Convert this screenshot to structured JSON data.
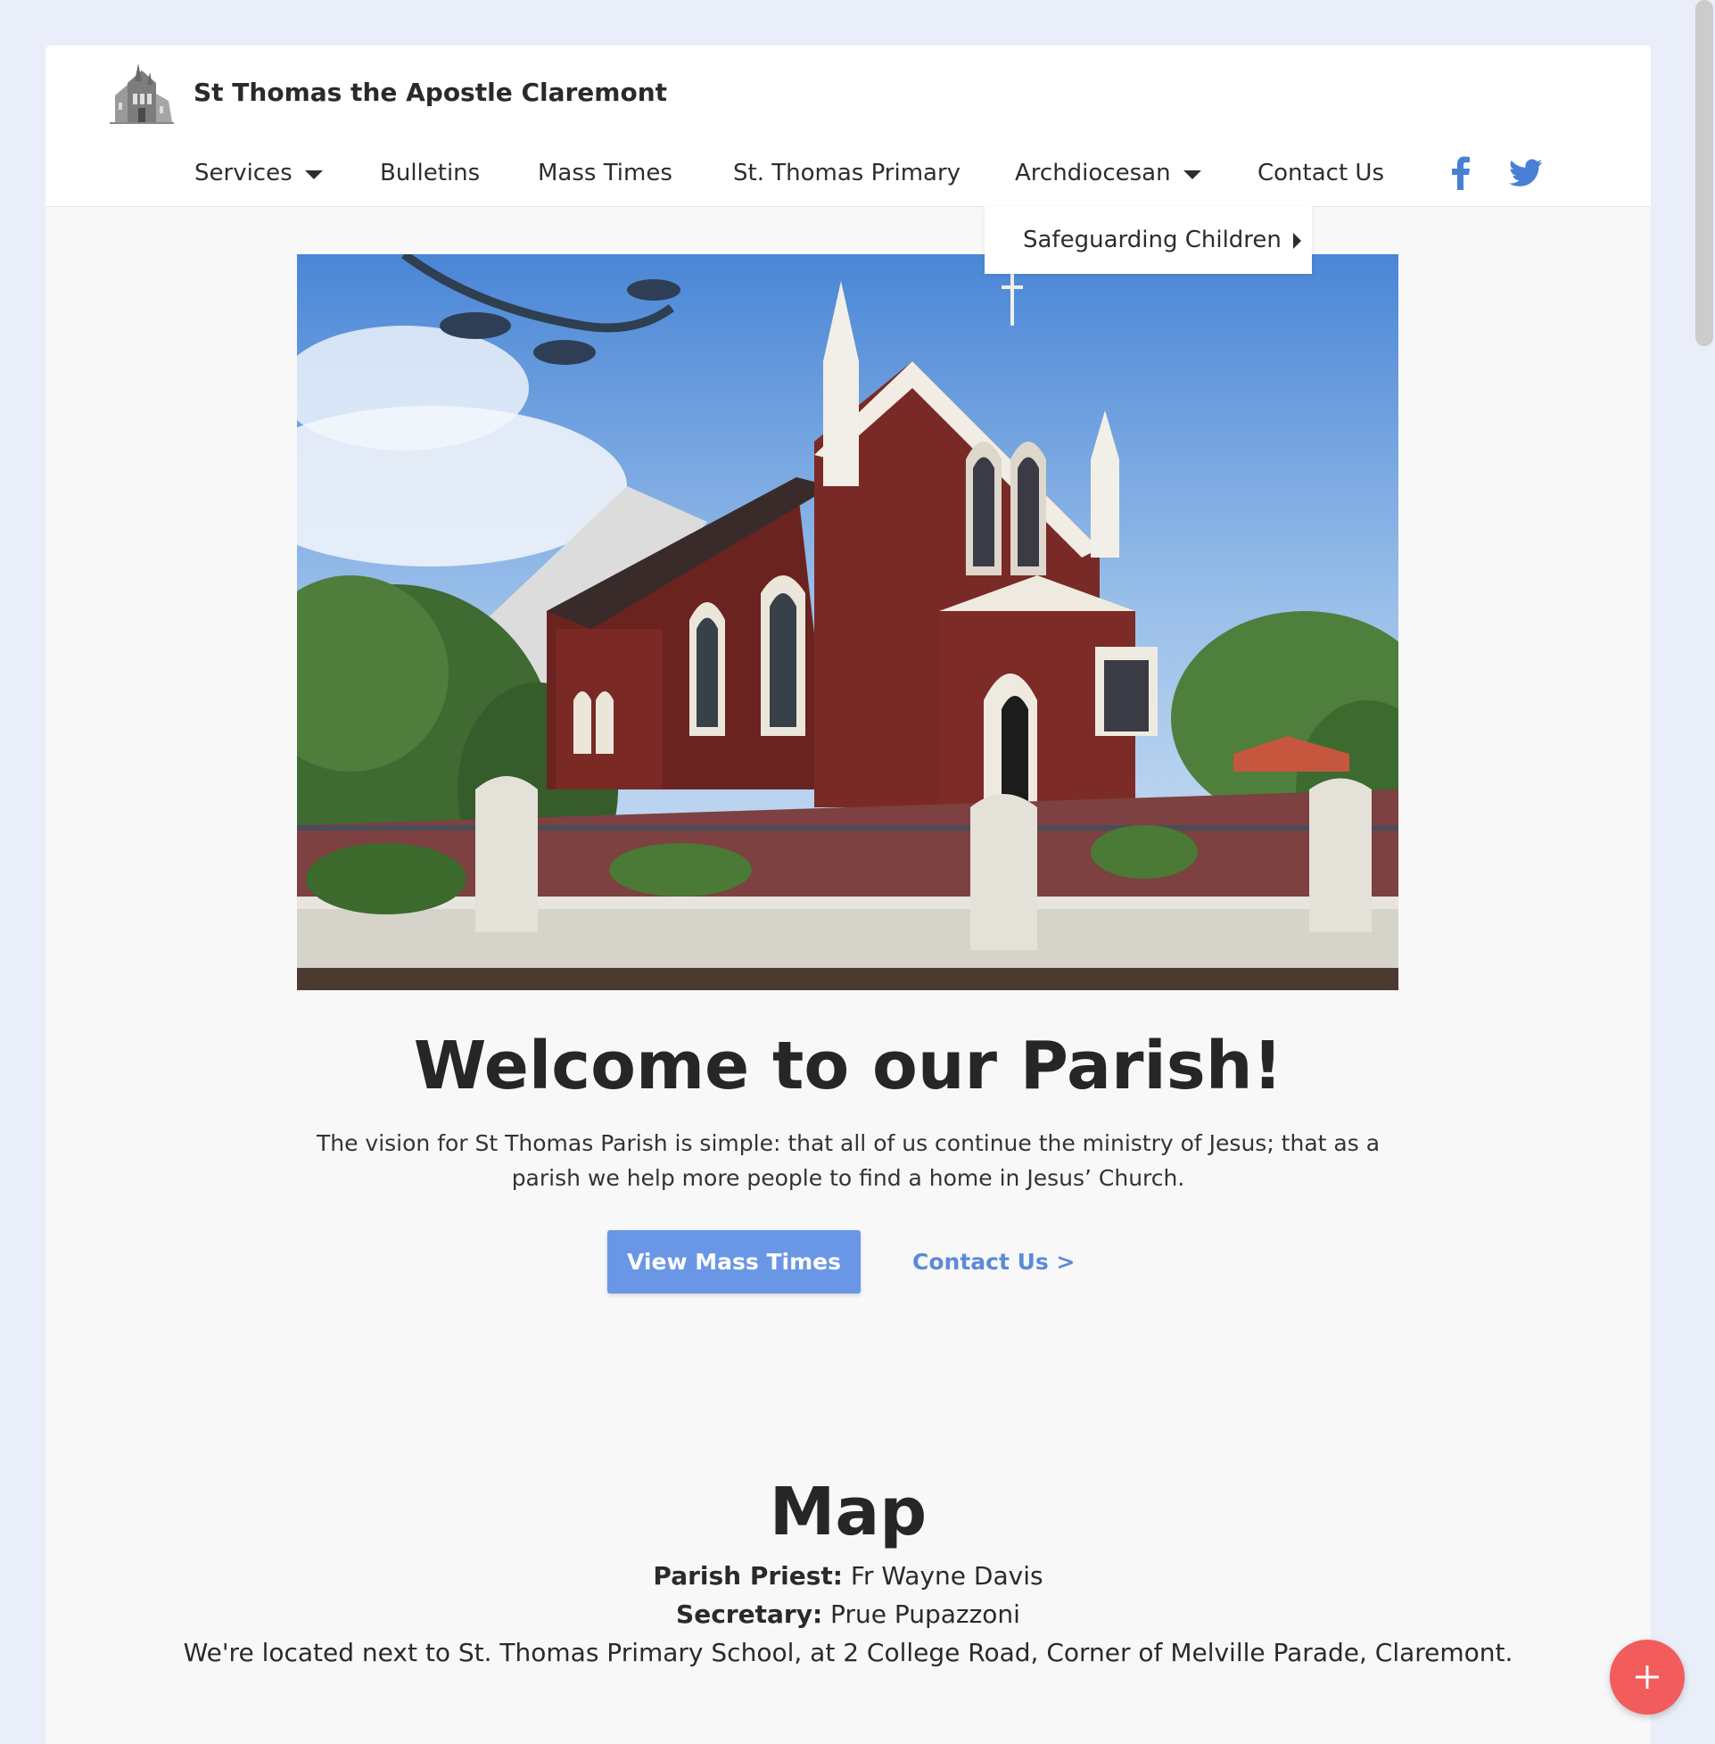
{
  "site": {
    "name": "St Thomas the Apostle Claremont",
    "logo_icon": "church-sketch-icon"
  },
  "nav": {
    "items": [
      {
        "label": "Services",
        "has_dropdown": true
      },
      {
        "label": "Bulletins",
        "has_dropdown": false
      },
      {
        "label": "Mass Times",
        "has_dropdown": false
      },
      {
        "label": "St. Thomas Primary",
        "has_dropdown": false
      },
      {
        "label": "Archdiocesan",
        "has_dropdown": true
      },
      {
        "label": "Contact Us",
        "has_dropdown": false
      }
    ],
    "social": [
      {
        "name": "facebook-icon",
        "color": "#4a7fd6"
      },
      {
        "name": "twitter-icon",
        "color": "#4a7fd6"
      }
    ]
  },
  "dropdown": {
    "open_under": "Archdiocesan",
    "items": [
      {
        "label": "Safeguarding Children",
        "has_submenu": true
      }
    ]
  },
  "hero": {
    "image_description_icon": "church-photo"
  },
  "welcome": {
    "heading": "Welcome to our Parish!",
    "text": "The vision for St Thomas Parish is simple: that all of us continue the ministry of Jesus; that as a parish we help more people to find a home in Jesus’ Church.",
    "primary_button": "View Mass Times",
    "secondary_link": "Contact Us >"
  },
  "map_section": {
    "heading": "Map",
    "priest_label": "Parish Priest:",
    "priest_name": "Fr Wayne Davis",
    "secretary_label": "Secretary:",
    "secretary_name": "Prue Pupazzoni",
    "location": "We're located next to St. Thomas Primary School, at 2 College Road, Corner of Melville Parade, Claremont."
  },
  "colors": {
    "accent": "#6a96e6",
    "link": "#5c8ad8",
    "fab": "#f25c5c",
    "page_bg": "#e9eef8"
  }
}
